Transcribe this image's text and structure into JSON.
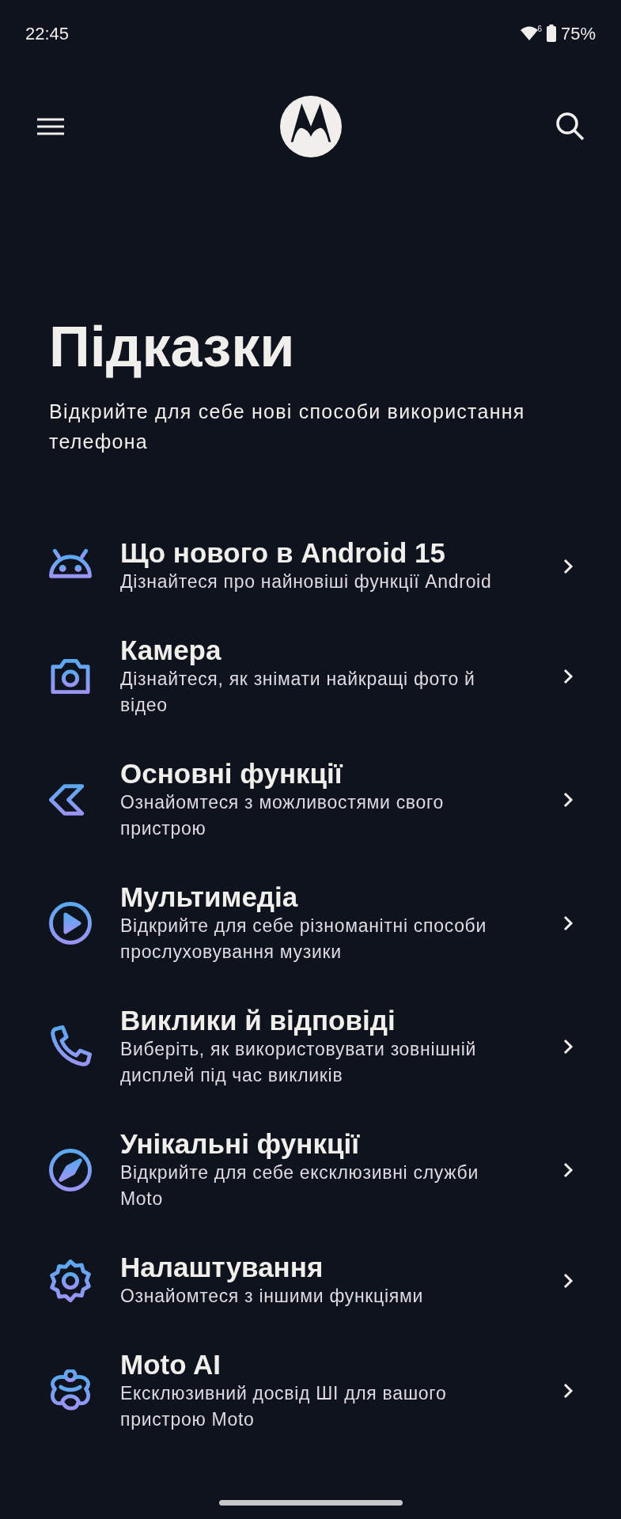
{
  "status_bar": {
    "time": "22:45",
    "wifi_badge": "6",
    "battery": "75%"
  },
  "title": "Підказки",
  "subtitle": "Відкрийте для себе нові способи використання телефона",
  "items": [
    {
      "title": "Що нового в Android 15",
      "description": "Дізнайтеся про найновіші функції Android"
    },
    {
      "title": "Камера",
      "description": "Дізнайтеся, як знімати найкращі фото й відео"
    },
    {
      "title": "Основні функції",
      "description": "Ознайомтеся з можливостями свого пристрою"
    },
    {
      "title": "Мультимедіа",
      "description": "Відкрийте для себе різноманітні способи прослуховування музики"
    },
    {
      "title": "Виклики й відповіді",
      "description": "Виберіть, як використовувати зовнішній дисплей під час викликів"
    },
    {
      "title": "Унікальні функції",
      "description": "Відкрийте для себе ексклюзивні служби Moto"
    },
    {
      "title": "Налаштування",
      "description": "Ознайомтеся з іншими функціями"
    },
    {
      "title": "Moto AI",
      "description": "Ексклюзивний досвід ШІ для вашого пристрою Moto"
    }
  ]
}
